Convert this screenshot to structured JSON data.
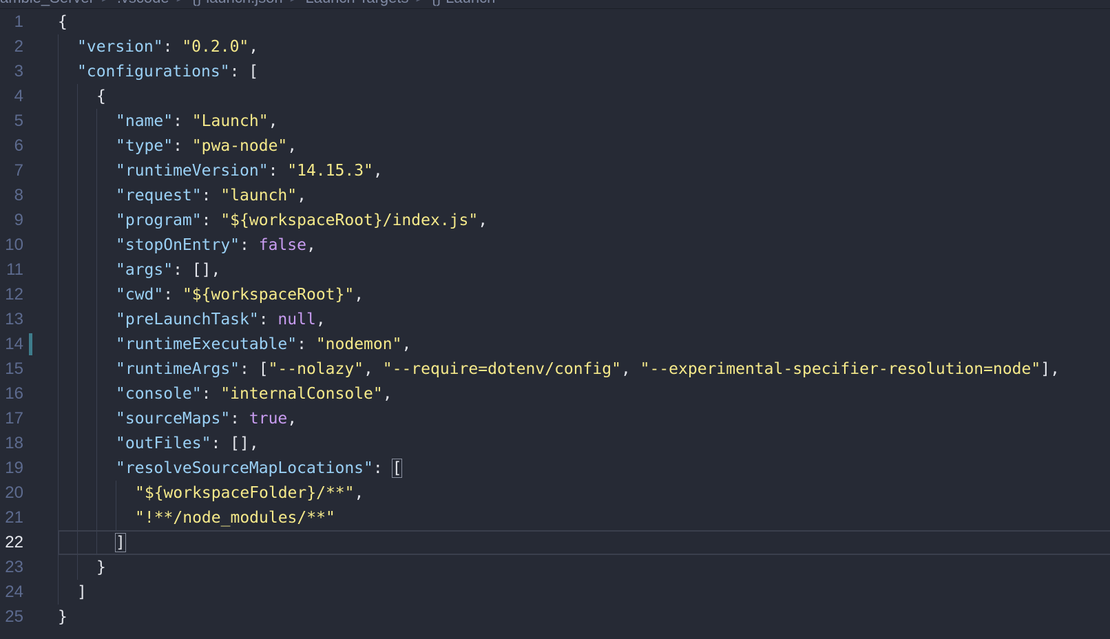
{
  "breadcrumb": {
    "items": [
      "ambie_Server",
      ".vscode",
      "{} launch.json",
      "Launch Targets",
      "{} Launch"
    ],
    "separator": ">"
  },
  "editor": {
    "current_line": 22,
    "modified_line": 14,
    "lines": [
      {
        "num": "1",
        "indent": 0,
        "tokens": [
          {
            "t": "{",
            "c": "p"
          }
        ]
      },
      {
        "num": "2",
        "indent": 1,
        "tokens": [
          {
            "t": "\"version\"",
            "c": "k"
          },
          {
            "t": ": ",
            "c": "p"
          },
          {
            "t": "\"0.2.0\"",
            "c": "s"
          },
          {
            "t": ",",
            "c": "p"
          }
        ]
      },
      {
        "num": "3",
        "indent": 1,
        "tokens": [
          {
            "t": "\"configurations\"",
            "c": "k"
          },
          {
            "t": ": [",
            "c": "p"
          }
        ]
      },
      {
        "num": "4",
        "indent": 2,
        "tokens": [
          {
            "t": "{",
            "c": "p"
          }
        ]
      },
      {
        "num": "5",
        "indent": 3,
        "tokens": [
          {
            "t": "\"name\"",
            "c": "k"
          },
          {
            "t": ": ",
            "c": "p"
          },
          {
            "t": "\"Launch\"",
            "c": "s"
          },
          {
            "t": ",",
            "c": "p"
          }
        ]
      },
      {
        "num": "6",
        "indent": 3,
        "tokens": [
          {
            "t": "\"type\"",
            "c": "k"
          },
          {
            "t": ": ",
            "c": "p"
          },
          {
            "t": "\"pwa-node\"",
            "c": "s"
          },
          {
            "t": ",",
            "c": "p"
          }
        ]
      },
      {
        "num": "7",
        "indent": 3,
        "tokens": [
          {
            "t": "\"runtimeVersion\"",
            "c": "k"
          },
          {
            "t": ": ",
            "c": "p"
          },
          {
            "t": "\"14.15.3\"",
            "c": "s"
          },
          {
            "t": ",",
            "c": "p"
          }
        ]
      },
      {
        "num": "8",
        "indent": 3,
        "tokens": [
          {
            "t": "\"request\"",
            "c": "k"
          },
          {
            "t": ": ",
            "c": "p"
          },
          {
            "t": "\"launch\"",
            "c": "s"
          },
          {
            "t": ",",
            "c": "p"
          }
        ]
      },
      {
        "num": "9",
        "indent": 3,
        "tokens": [
          {
            "t": "\"program\"",
            "c": "k"
          },
          {
            "t": ": ",
            "c": "p"
          },
          {
            "t": "\"${workspaceRoot}/index.js\"",
            "c": "s"
          },
          {
            "t": ",",
            "c": "p"
          }
        ]
      },
      {
        "num": "10",
        "indent": 3,
        "tokens": [
          {
            "t": "\"stopOnEntry\"",
            "c": "k"
          },
          {
            "t": ": ",
            "c": "p"
          },
          {
            "t": "false",
            "c": "b"
          },
          {
            "t": ",",
            "c": "p"
          }
        ]
      },
      {
        "num": "11",
        "indent": 3,
        "tokens": [
          {
            "t": "\"args\"",
            "c": "k"
          },
          {
            "t": ": [],",
            "c": "p"
          }
        ]
      },
      {
        "num": "12",
        "indent": 3,
        "tokens": [
          {
            "t": "\"cwd\"",
            "c": "k"
          },
          {
            "t": ": ",
            "c": "p"
          },
          {
            "t": "\"${workspaceRoot}\"",
            "c": "s"
          },
          {
            "t": ",",
            "c": "p"
          }
        ]
      },
      {
        "num": "13",
        "indent": 3,
        "tokens": [
          {
            "t": "\"preLaunchTask\"",
            "c": "k"
          },
          {
            "t": ": ",
            "c": "p"
          },
          {
            "t": "null",
            "c": "b"
          },
          {
            "t": ",",
            "c": "p"
          }
        ]
      },
      {
        "num": "14",
        "indent": 3,
        "tokens": [
          {
            "t": "\"runtimeExecutable\"",
            "c": "k"
          },
          {
            "t": ": ",
            "c": "p"
          },
          {
            "t": "\"nodemon\"",
            "c": "s"
          },
          {
            "t": ",",
            "c": "p"
          }
        ]
      },
      {
        "num": "15",
        "indent": 3,
        "tokens": [
          {
            "t": "\"runtimeArgs\"",
            "c": "k"
          },
          {
            "t": ": [",
            "c": "p"
          },
          {
            "t": "\"--nolazy\"",
            "c": "s"
          },
          {
            "t": ", ",
            "c": "p"
          },
          {
            "t": "\"--require=dotenv/config\"",
            "c": "s"
          },
          {
            "t": ", ",
            "c": "p"
          },
          {
            "t": "\"--experimental-specifier-resolution=node\"",
            "c": "s"
          },
          {
            "t": "],",
            "c": "p"
          }
        ]
      },
      {
        "num": "16",
        "indent": 3,
        "tokens": [
          {
            "t": "\"console\"",
            "c": "k"
          },
          {
            "t": ": ",
            "c": "p"
          },
          {
            "t": "\"internalConsole\"",
            "c": "s"
          },
          {
            "t": ",",
            "c": "p"
          }
        ]
      },
      {
        "num": "17",
        "indent": 3,
        "tokens": [
          {
            "t": "\"sourceMaps\"",
            "c": "k"
          },
          {
            "t": ": ",
            "c": "p"
          },
          {
            "t": "true",
            "c": "b"
          },
          {
            "t": ",",
            "c": "p"
          }
        ]
      },
      {
        "num": "18",
        "indent": 3,
        "tokens": [
          {
            "t": "\"outFiles\"",
            "c": "k"
          },
          {
            "t": ": [],",
            "c": "p"
          }
        ]
      },
      {
        "num": "19",
        "indent": 3,
        "tokens": [
          {
            "t": "\"resolveSourceMapLocations\"",
            "c": "k"
          },
          {
            "t": ": ",
            "c": "p"
          },
          {
            "t": "[",
            "c": "p",
            "box": true
          }
        ]
      },
      {
        "num": "20",
        "indent": 4,
        "tokens": [
          {
            "t": "\"${workspaceFolder}/**\"",
            "c": "s"
          },
          {
            "t": ",",
            "c": "p"
          }
        ]
      },
      {
        "num": "21",
        "indent": 4,
        "tokens": [
          {
            "t": "\"!**/node_modules/**\"",
            "c": "s"
          }
        ]
      },
      {
        "num": "22",
        "indent": 3,
        "tokens": [
          {
            "t": "]",
            "c": "p",
            "box": true
          }
        ]
      },
      {
        "num": "23",
        "indent": 2,
        "tokens": [
          {
            "t": "}",
            "c": "p"
          }
        ]
      },
      {
        "num": "24",
        "indent": 1,
        "tokens": [
          {
            "t": "]",
            "c": "p"
          }
        ]
      },
      {
        "num": "25",
        "indent": 0,
        "tokens": [
          {
            "t": "}",
            "c": "p"
          }
        ]
      }
    ]
  }
}
